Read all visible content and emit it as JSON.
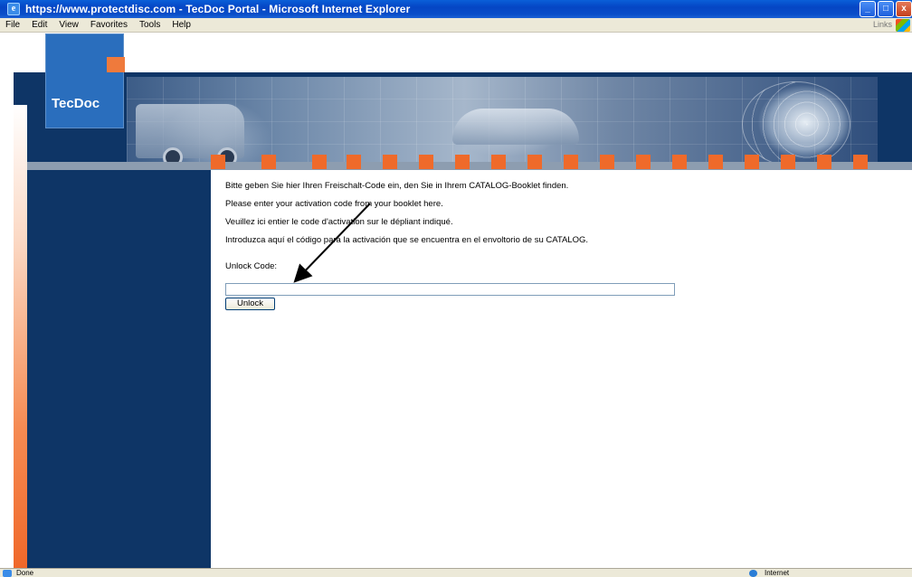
{
  "window": {
    "title": "https://www.protectdisc.com - TecDoc Portal - Microsoft Internet Explorer",
    "minimize": "_",
    "maximize": "□",
    "close": "x"
  },
  "menu": {
    "items": [
      "File",
      "Edit",
      "View",
      "Favorites",
      "Tools",
      "Help"
    ],
    "links_label": "Links"
  },
  "logo": {
    "text": "TecDoc"
  },
  "content": {
    "lines": [
      "Bitte geben Sie hier Ihren Freischalt-Code ein, den Sie in Ihrem CATALOG-Booklet finden.",
      "Please enter your activation code from your booklet here.",
      "Veuillez ici entier le code d'activation sur le dépliant indiqué.",
      "Introduzca aquí el código para la activación que se encuentra en el envoltorio de su CATALOG."
    ],
    "unlock_label": "Unlock Code:",
    "unlock_value": "",
    "unlock_button": "Unlock"
  },
  "status": {
    "text": "Done",
    "zone": "Internet"
  },
  "colors": {
    "navy": "#0e3566",
    "orange": "#ef6a2a",
    "titlebar": "#0545c4"
  }
}
